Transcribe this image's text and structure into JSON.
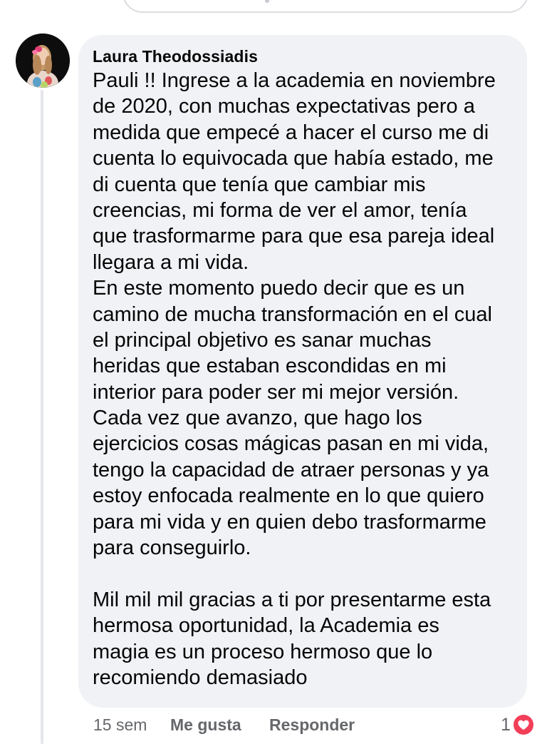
{
  "comment": {
    "author": "Laura Theodossiadis",
    "lines": [
      "Pauli !! Ingrese a la academia en noviembre",
      "de 2020, con muchas expectativas pero a",
      "medida que empecé a hacer el curso me di",
      "cuenta lo equivocada que había estado, me",
      "di cuenta que tenía que cambiar mis",
      "creencias, mi forma de ver el amor, tenía",
      "que trasformarme para que esa pareja ideal",
      "llegara a mi vida.",
      "En este momento puedo decir que es un",
      "camino de mucha transformación en el cual",
      "el principal objetivo es sanar muchas",
      "heridas que estaban escondidas en mi",
      "interior para poder ser mi mejor versión.",
      "Cada vez que avanzo, que hago los",
      "ejercicios cosas mágicas pasan en mi vida,",
      "tengo la capacidad de atraer personas y ya",
      "estoy enfocada realmente en lo que quiero",
      "para mi vida y en quien debo trasformarme",
      "para conseguirlo.",
      "",
      "Mil mil mil gracias a ti por presentarme esta",
      "hermosa oportunidad,  la Academia es",
      "magia es un proceso hermoso que lo",
      "recomiendo demasiado"
    ]
  },
  "actions": {
    "time": "15 sem",
    "like_label": "Me gusta",
    "reply_label": "Responder",
    "reaction_count": "1",
    "reaction_icon": "heart-icon"
  },
  "colors": {
    "bubble_bg": "#f0f2f5",
    "text": "#050505",
    "secondary_text": "#65676b",
    "heart": "#f33e58"
  }
}
